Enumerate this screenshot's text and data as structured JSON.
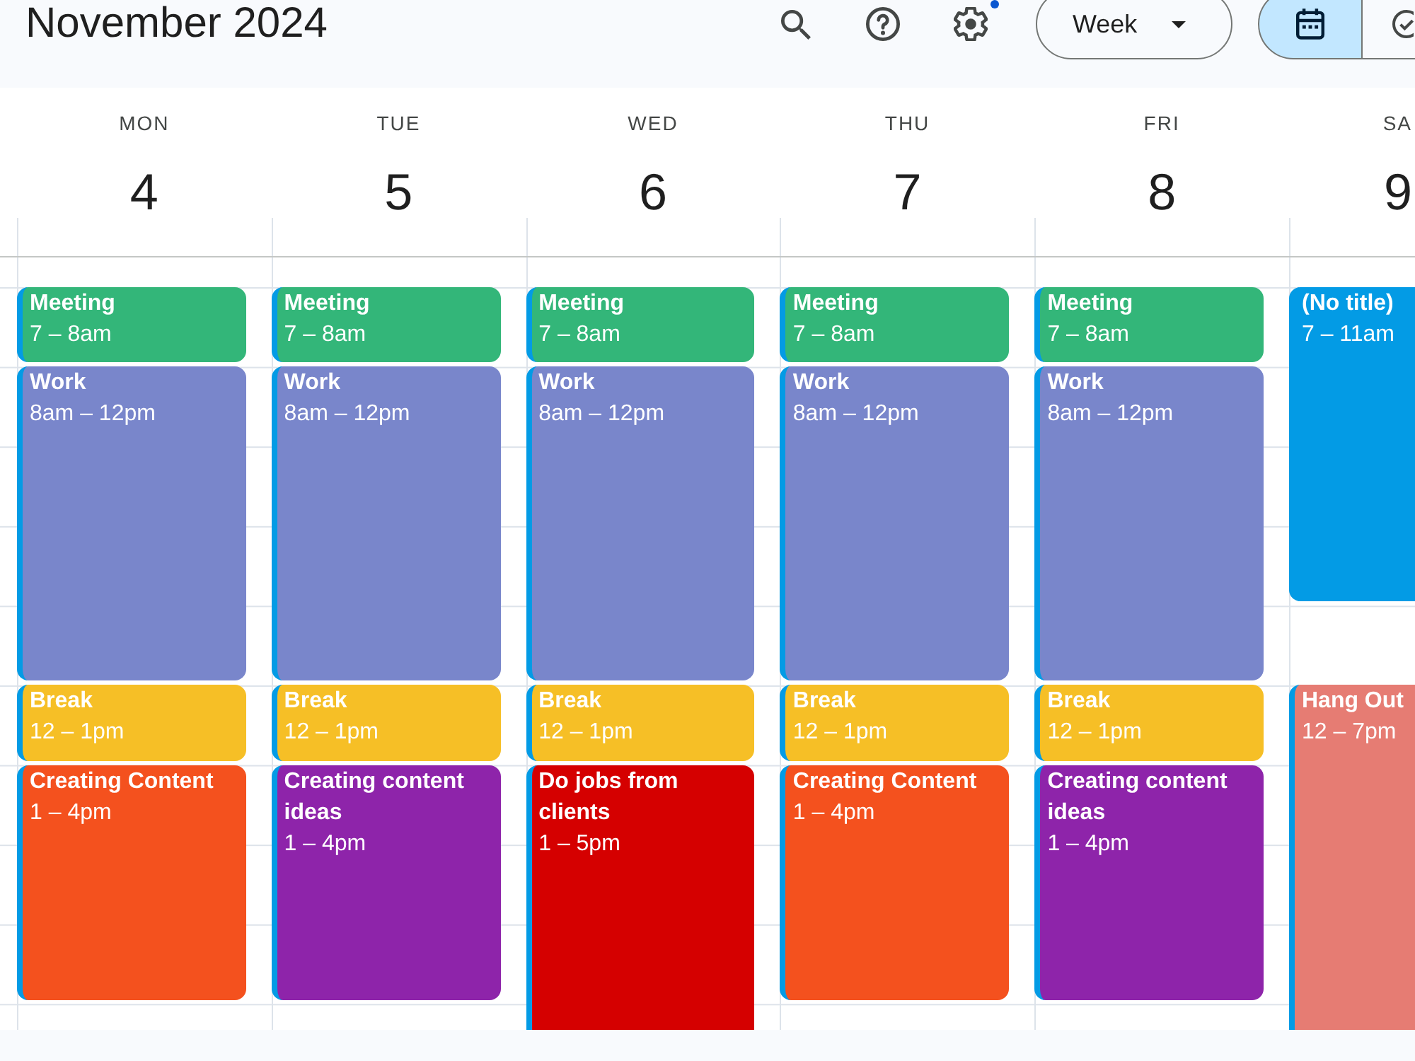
{
  "header": {
    "title": "November 2024",
    "tools": [
      {
        "kind": "search",
        "badge": false
      },
      {
        "kind": "help",
        "badge": false
      },
      {
        "kind": "settings",
        "badge": true
      }
    ],
    "view_menu": {
      "label": "Week"
    },
    "view_toggle": [
      {
        "kind": "calendar",
        "selected": true
      },
      {
        "kind": "tasks",
        "selected": false
      }
    ]
  },
  "days": [
    {
      "name": "MON",
      "number": "4",
      "events": [
        {
          "title": "Meeting",
          "time": "7 – 8am",
          "color": "#33b679"
        },
        {
          "title": "Work",
          "time": "8am – 12pm",
          "color": "#7986cb"
        },
        {
          "title": "Break",
          "time": "12 – 1pm",
          "color": "#f6bf26"
        },
        {
          "title": "Creating Content",
          "time": "1 – 4pm",
          "color": "#f4511e"
        }
      ]
    },
    {
      "name": "TUE",
      "number": "5",
      "events": [
        {
          "title": "Meeting",
          "time": "7 – 8am",
          "color": "#33b679"
        },
        {
          "title": "Work",
          "time": "8am – 12pm",
          "color": "#7986cb"
        },
        {
          "title": "Break",
          "time": "12 – 1pm",
          "color": "#f6bf26"
        },
        {
          "title": "Creating content ideas",
          "time": "1 – 4pm",
          "color": "#8e24aa"
        }
      ]
    },
    {
      "name": "WED",
      "number": "6",
      "events": [
        {
          "title": "Meeting",
          "time": "7 – 8am",
          "color": "#33b679"
        },
        {
          "title": "Work",
          "time": "8am – 12pm",
          "color": "#7986cb"
        },
        {
          "title": "Break",
          "time": "12 – 1pm",
          "color": "#f6bf26"
        },
        {
          "title": "Do jobs from clients",
          "time": "1 – 5pm",
          "color": "#d50000"
        }
      ]
    },
    {
      "name": "THU",
      "number": "7",
      "events": [
        {
          "title": "Meeting",
          "time": "7 – 8am",
          "color": "#33b679"
        },
        {
          "title": "Work",
          "time": "8am – 12pm",
          "color": "#7986cb"
        },
        {
          "title": "Break",
          "time": "12 – 1pm",
          "color": "#f6bf26"
        },
        {
          "title": "Creating Content",
          "time": "1 – 4pm",
          "color": "#f4511e"
        }
      ]
    },
    {
      "name": "FRI",
      "number": "8",
      "events": [
        {
          "title": "Meeting",
          "time": "7 – 8am",
          "color": "#33b679"
        },
        {
          "title": "Work",
          "time": "8am – 12pm",
          "color": "#7986cb"
        },
        {
          "title": "Break",
          "time": "12 – 1pm",
          "color": "#f6bf26"
        },
        {
          "title": "Creating content ideas",
          "time": "1 – 4pm",
          "color": "#8e24aa"
        }
      ]
    },
    {
      "name": "SA",
      "number": "9",
      "events": [
        {
          "title": "(No title)",
          "time": "7 – 11am",
          "color": "#039be5"
        },
        {
          "title": "Hang Out",
          "time": "12 – 7pm",
          "color": "#e67c73"
        }
      ]
    }
  ]
}
